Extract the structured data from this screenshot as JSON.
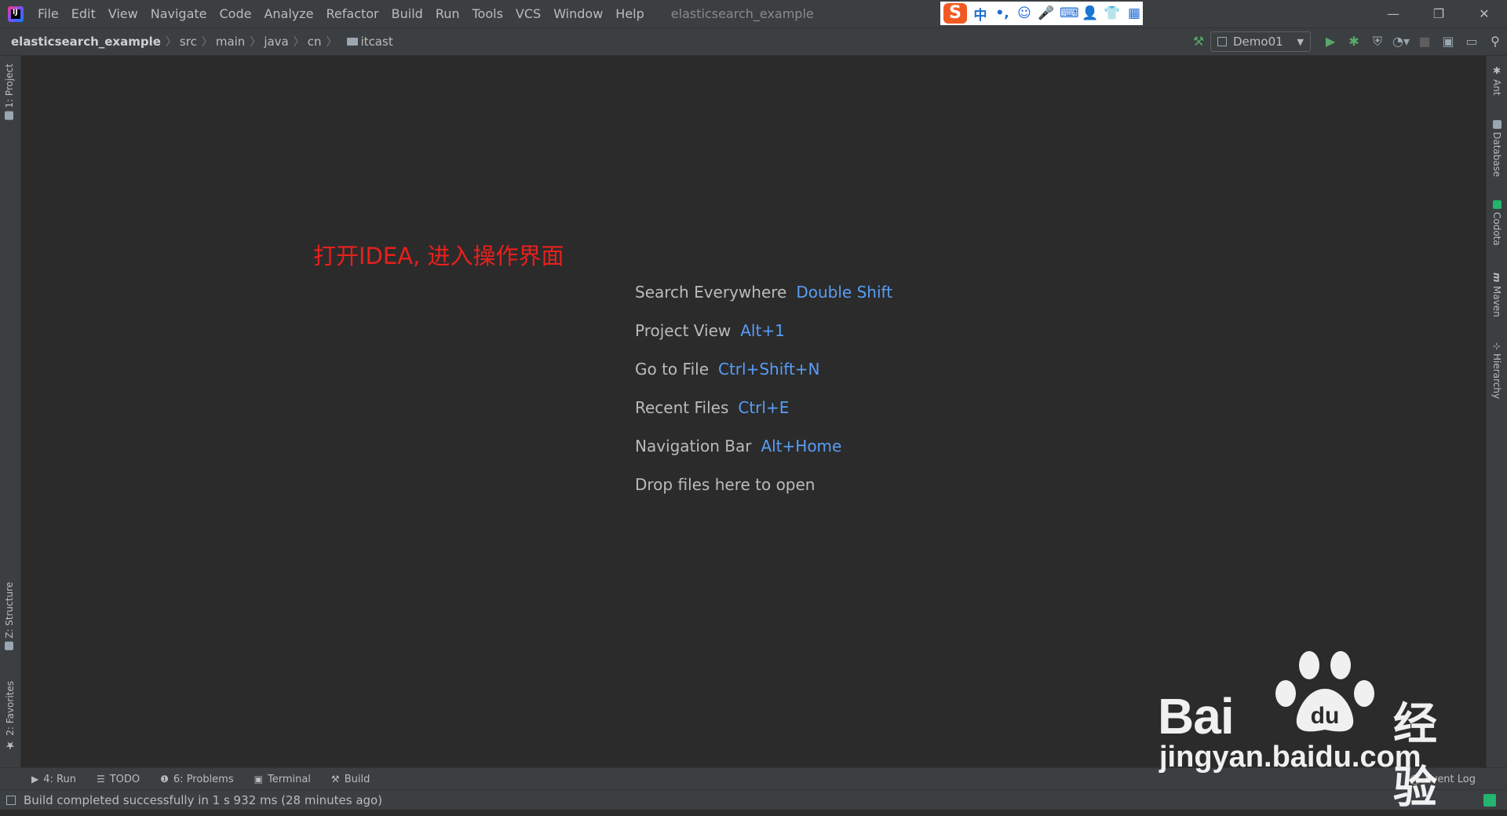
{
  "menubar": {
    "items": [
      "File",
      "Edit",
      "View",
      "Navigate",
      "Code",
      "Analyze",
      "Refactor",
      "Build",
      "Run",
      "Tools",
      "VCS",
      "Window",
      "Help"
    ],
    "window_title": "elasticsearch_example",
    "ime": {
      "logo": "S",
      "mode": "中",
      "punct": "•,"
    }
  },
  "navbar": {
    "breadcrumbs": [
      "elasticsearch_example",
      "src",
      "main",
      "java",
      "cn",
      "itcast"
    ],
    "run_config": "Demo01"
  },
  "left_tabs": {
    "project": "1: Project",
    "structure": "Z: Structure",
    "favorites": "2: Favorites"
  },
  "right_tabs": {
    "ant": "Ant",
    "database": "Database",
    "codota": "Codota",
    "maven": "Maven",
    "hierarchy": "Hierarchy"
  },
  "annotation": "打开IDEA, 进入操作界面",
  "hints": [
    {
      "label": "Search Everywhere",
      "key": "Double Shift"
    },
    {
      "label": "Project View",
      "key": "Alt+1"
    },
    {
      "label": "Go to File",
      "key": "Ctrl+Shift+N"
    },
    {
      "label": "Recent Files",
      "key": "Ctrl+E"
    },
    {
      "label": "Navigation Bar",
      "key": "Alt+Home"
    },
    {
      "label": "Drop files here to open",
      "key": ""
    }
  ],
  "toolwindows": {
    "run": "4: Run",
    "todo": "TODO",
    "problems": "6: Problems",
    "terminal": "Terminal",
    "build": "Build",
    "event_log": "Event Log"
  },
  "status": {
    "message": "Build completed successfully in 1 s 932 ms (28 minutes ago)"
  },
  "watermark": {
    "brand": "Bai",
    "du": "du",
    "jingyan": "经验",
    "url": "jingyan.baidu.com"
  },
  "colors": {
    "background": "#2b2b2b",
    "panel": "#3c3f41",
    "shortcut": "#589df6",
    "annotation": "#e8201c",
    "run_green": "#59a869"
  }
}
